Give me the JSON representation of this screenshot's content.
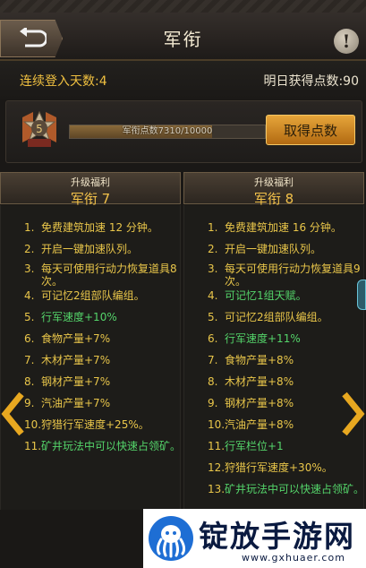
{
  "header": {
    "title": "军衔",
    "info_label": "!"
  },
  "stats": {
    "login_days": "连续登入天数:4",
    "tomorrow_points": "明日获得点数:90"
  },
  "progress": {
    "text": "军衔点数7310/10000",
    "fraction": 0.731,
    "button_label": "取得点数"
  },
  "columns": [
    {
      "subtitle": "升级福利",
      "rank": "军衔 7",
      "items": [
        {
          "num": "1.",
          "text": "免费建筑加速 12 分钟。",
          "color": "yellow"
        },
        {
          "num": "2.",
          "text": "开启一键加速队列。",
          "color": "yellow"
        },
        {
          "num": "3.",
          "text": "每天可使用行动力恢复道具8次。",
          "color": "yellow"
        },
        {
          "num": "4.",
          "text": "可记忆2组部队编组。",
          "color": "yellow"
        },
        {
          "num": "5.",
          "text": "行军速度+10%",
          "color": "green"
        },
        {
          "num": "6.",
          "text": "食物产量+7%",
          "color": "yellow"
        },
        {
          "num": "7.",
          "text": "木材产量+7%",
          "color": "yellow"
        },
        {
          "num": "8.",
          "text": "钢材产量+7%",
          "color": "yellow"
        },
        {
          "num": "9.",
          "text": "汽油产量+7%",
          "color": "yellow"
        },
        {
          "num": "10.",
          "text": "狩猎行军速度+25%。",
          "color": "yellow"
        },
        {
          "num": "11.",
          "text": "矿井玩法中可以快速占领矿。",
          "color": "green"
        }
      ]
    },
    {
      "subtitle": "升级福利",
      "rank": "军衔 8",
      "items": [
        {
          "num": "1.",
          "text": "免费建筑加速 16 分钟。",
          "color": "yellow"
        },
        {
          "num": "2.",
          "text": "开启一键加速队列。",
          "color": "yellow"
        },
        {
          "num": "3.",
          "text": "每天可使用行动力恢复道具9次。",
          "color": "yellow"
        },
        {
          "num": "4.",
          "text": "可记忆1组天赋。",
          "color": "green"
        },
        {
          "num": "5.",
          "text": "可记忆2组部队编组。",
          "color": "yellow"
        },
        {
          "num": "6.",
          "text": "行军速度+11%",
          "color": "green"
        },
        {
          "num": "7.",
          "text": "食物产量+8%",
          "color": "yellow"
        },
        {
          "num": "8.",
          "text": "木材产量+8%",
          "color": "yellow"
        },
        {
          "num": "9.",
          "text": "钢材产量+8%",
          "color": "yellow"
        },
        {
          "num": "10.",
          "text": "汽油产量+8%",
          "color": "yellow"
        },
        {
          "num": "11.",
          "text": "行军栏位+1",
          "color": "green"
        },
        {
          "num": "12.",
          "text": "狩猎行军速度+30%。",
          "color": "yellow"
        },
        {
          "num": "13.",
          "text": "矿井玩法中可以快速占领矿。",
          "color": "green"
        }
      ]
    }
  ],
  "watermark": {
    "name": "锭放手游网",
    "url": "www.gxhuaer.com"
  },
  "icons": {
    "back": "back-arrow-icon",
    "rank": "rank-badge-icon",
    "prev": "chevron-left-icon",
    "next": "chevron-right-icon"
  }
}
